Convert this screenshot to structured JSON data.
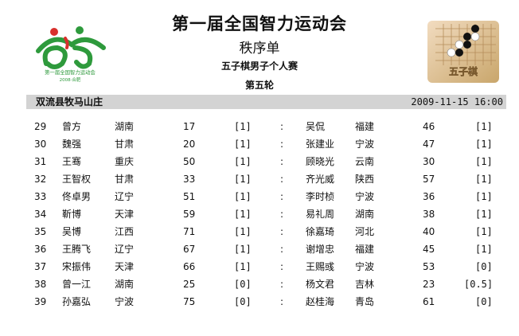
{
  "header": {
    "title": "第一届全国智力运动会",
    "subtitle": "秩序单",
    "event": "五子棋男子个人赛",
    "round": "第五轮"
  },
  "logo": {
    "caption_line1": "第一届全国智力运动会",
    "caption_line2": "2008·合肥"
  },
  "badge": {
    "label": "五子棋"
  },
  "info_bar": {
    "venue": "双流县牧马山庄",
    "datetime": "2009-11-15 16:00"
  },
  "colors": {
    "bar_bg": "#d3d3d3",
    "logo_green": "#2e9a3c",
    "logo_red": "#d8302c",
    "badge_gold": "#c9a66b"
  },
  "rows": [
    {
      "no": "29",
      "p1": "曾方",
      "r1": "湖南",
      "s1": "17",
      "pt1": "[1]",
      "sep": ":",
      "p2": "吴侃",
      "r2": "福建",
      "s2": "46",
      "pt2": "[1]"
    },
    {
      "no": "30",
      "p1": "魏强",
      "r1": "甘肃",
      "s1": "20",
      "pt1": "[1]",
      "sep": ":",
      "p2": "张建业",
      "r2": "宁波",
      "s2": "47",
      "pt2": "[1]"
    },
    {
      "no": "31",
      "p1": "王骞",
      "r1": "重庆",
      "s1": "50",
      "pt1": "[1]",
      "sep": ":",
      "p2": "顾晓光",
      "r2": "云南",
      "s2": "30",
      "pt2": "[1]"
    },
    {
      "no": "32",
      "p1": "王智权",
      "r1": "甘肃",
      "s1": "33",
      "pt1": "[1]",
      "sep": ":",
      "p2": "齐光威",
      "r2": "陕西",
      "s2": "57",
      "pt2": "[1]"
    },
    {
      "no": "33",
      "p1": "佟卓男",
      "r1": "辽宁",
      "s1": "51",
      "pt1": "[1]",
      "sep": ":",
      "p2": "李时桢",
      "r2": "宁波",
      "s2": "36",
      "pt2": "[1]"
    },
    {
      "no": "34",
      "p1": "靳博",
      "r1": "天津",
      "s1": "59",
      "pt1": "[1]",
      "sep": ":",
      "p2": "易礼周",
      "r2": "湖南",
      "s2": "38",
      "pt2": "[1]"
    },
    {
      "no": "35",
      "p1": "吴博",
      "r1": "江西",
      "s1": "71",
      "pt1": "[1]",
      "sep": ":",
      "p2": "徐嘉琦",
      "r2": "河北",
      "s2": "40",
      "pt2": "[1]"
    },
    {
      "no": "36",
      "p1": "王腾飞",
      "r1": "辽宁",
      "s1": "67",
      "pt1": "[1]",
      "sep": ":",
      "p2": "谢增忠",
      "r2": "福建",
      "s2": "45",
      "pt2": "[1]"
    },
    {
      "no": "37",
      "p1": "宋振伟",
      "r1": "天津",
      "s1": "66",
      "pt1": "[1]",
      "sep": ":",
      "p2": "王赐彧",
      "r2": "宁波",
      "s2": "53",
      "pt2": "[0]"
    },
    {
      "no": "38",
      "p1": "曾一江",
      "r1": "湖南",
      "s1": "25",
      "pt1": "[0]",
      "sep": ":",
      "p2": "杨文君",
      "r2": "吉林",
      "s2": "23",
      "pt2": "[0.5]"
    },
    {
      "no": "39",
      "p1": "孙嘉弘",
      "r1": "宁波",
      "s1": "75",
      "pt1": "[0]",
      "sep": ":",
      "p2": "赵桂海",
      "r2": "青岛",
      "s2": "61",
      "pt2": "[0]"
    }
  ]
}
